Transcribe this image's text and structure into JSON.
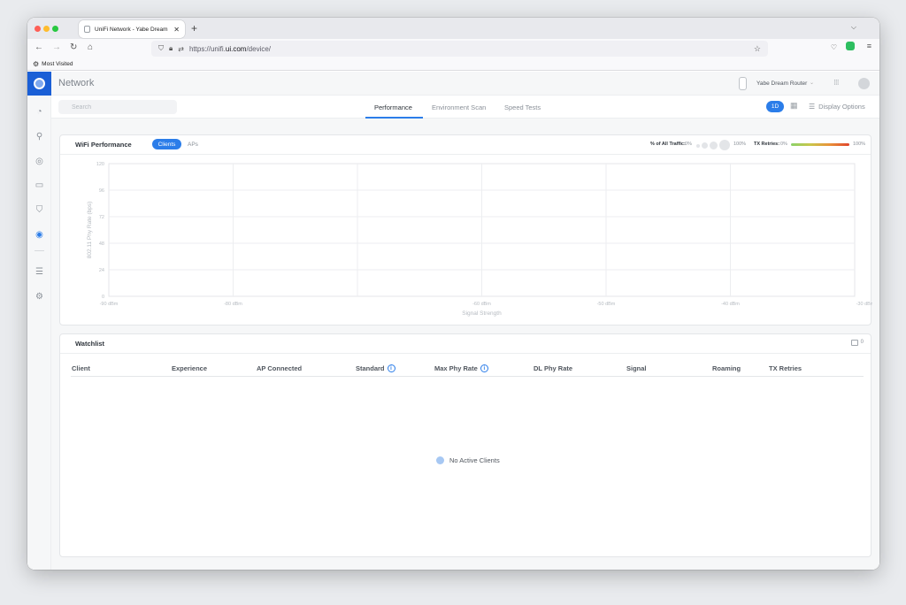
{
  "browser": {
    "tab_title": "UniFi Network - Yabe Dream Ro",
    "url_prefix": "https://unifi.",
    "url_domain": "ui.com",
    "url_path": "/device/",
    "bookmark": "Most Visited"
  },
  "app": {
    "title": "Network",
    "device_name": "Yabe Dream Router",
    "search_placeholder": "Search",
    "tabs": [
      {
        "label": "Performance",
        "active": true
      },
      {
        "label": "Environment Scan",
        "active": false
      },
      {
        "label": "Speed Tests",
        "active": false
      }
    ],
    "range_label": "1D",
    "display_options": "Display Options",
    "accent": "#2b7de9"
  },
  "sidebar": {
    "icons": [
      "dashboard-icon",
      "topology-icon",
      "devices-icon",
      "clients-icon",
      "security-icon",
      "wifi-insights-icon",
      "system-log-icon",
      "settings-icon"
    ]
  },
  "perf": {
    "title": "WiFi Performance",
    "seg_clients": "Clients",
    "seg_aps": "APs",
    "traffic_label": "% of All Traffic:",
    "traffic_min": "0%",
    "traffic_max": "100%",
    "retries_label": "TX Retries:",
    "retries_min": "0%",
    "retries_max": "100%"
  },
  "chart_data": {
    "type": "scatter",
    "title": "",
    "xlabel": "Signal Strength",
    "ylabel": "802.11 Phy Rate (bps)",
    "x_ticks": [
      "-90 dBm",
      "-80 dBm",
      "-60 dBm",
      "-50 dBm",
      "-40 dBm",
      "-30 dBm"
    ],
    "y_ticks": [
      "0",
      "24",
      "48",
      "72",
      "96",
      "120"
    ],
    "ylim": [
      0,
      120
    ],
    "grid": true,
    "series": []
  },
  "watchlist": {
    "title": "Watchlist",
    "count": "0",
    "columns": [
      "Client",
      "Experience",
      "AP Connected",
      "Standard",
      "Max Phy Rate",
      "DL Phy Rate",
      "Signal",
      "Roaming",
      "TX Retries"
    ],
    "empty_message": "No Active Clients"
  }
}
